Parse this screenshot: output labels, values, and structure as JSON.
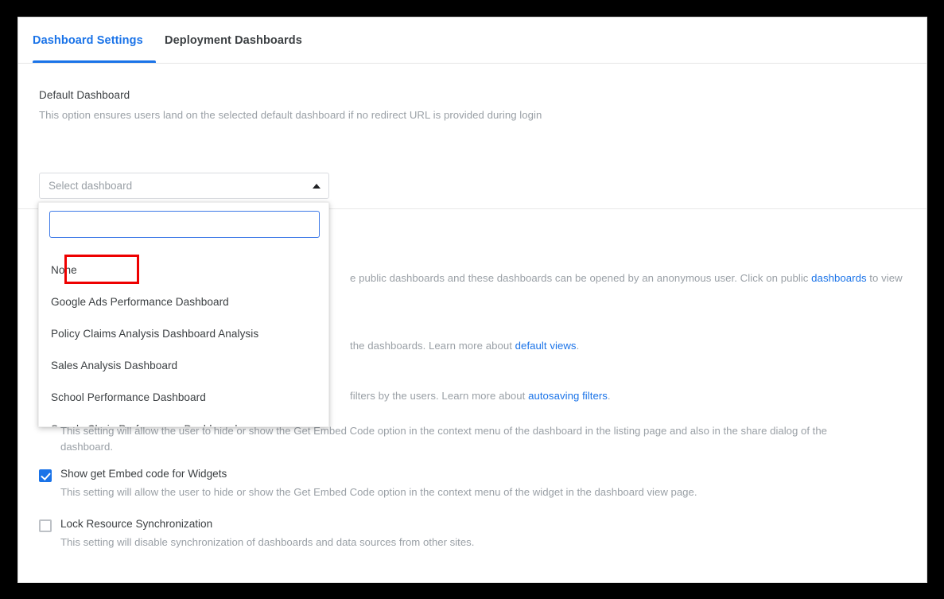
{
  "tabs": [
    {
      "label": "Dashboard Settings",
      "active": true
    },
    {
      "label": "Deployment Dashboards",
      "active": false
    }
  ],
  "default_dashboard": {
    "title": "Default Dashboard",
    "description": "This option ensures users land on the selected default dashboard if no redirect URL is provided during login",
    "select_placeholder": "Select dashboard",
    "caret_icon": "caret-up-icon"
  },
  "dropdown": {
    "search_value": "",
    "search_placeholder": "",
    "options": [
      "None",
      "Google Ads Performance Dashboard",
      "Policy Claims Analysis Dashboard Analysis",
      "Sales Analysis Dashboard",
      "School Performance Dashboard",
      "Supply Chain Performance Dashboard"
    ],
    "highlighted_option": "None",
    "highlight_color": "#ee0000"
  },
  "hidden_settings": [
    {
      "help_prefix": "",
      "help_visible": "e public dashboards and these dashboards can be opened by an anonymous user. Click on public ",
      "link": "dashboards",
      "help_suffix": " to view"
    },
    {
      "help_visible": "the dashboards. Learn more about ",
      "link": "default views",
      "help_suffix": "."
    },
    {
      "help_visible": "filters by the users. Learn more about ",
      "link": "autosaving filters",
      "help_suffix": "."
    }
  ],
  "settings": [
    {
      "checked": false,
      "label": "",
      "help_line1": "This setting will allow the user to hide or show the Get Embed Code option in the context menu of the dashboard in the listing page and also in the share dialog of the",
      "help_line2": "dashboard."
    },
    {
      "checked": true,
      "label": "Show get Embed code for Widgets",
      "help_line1": "This setting will allow the user to hide or show the Get Embed Code option in the context menu of the widget in the dashboard view page.",
      "help_line2": ""
    },
    {
      "checked": false,
      "label": "Lock Resource Synchronization",
      "help_line1": "This setting will disable synchronization of dashboards and data sources from other sites.",
      "help_line2": ""
    }
  ],
  "colors": {
    "accent": "#1a73e8",
    "link": "#1a73e8",
    "muted_text": "#9aa0a6",
    "body_text": "#3c4043",
    "highlight": "#ee0000"
  }
}
